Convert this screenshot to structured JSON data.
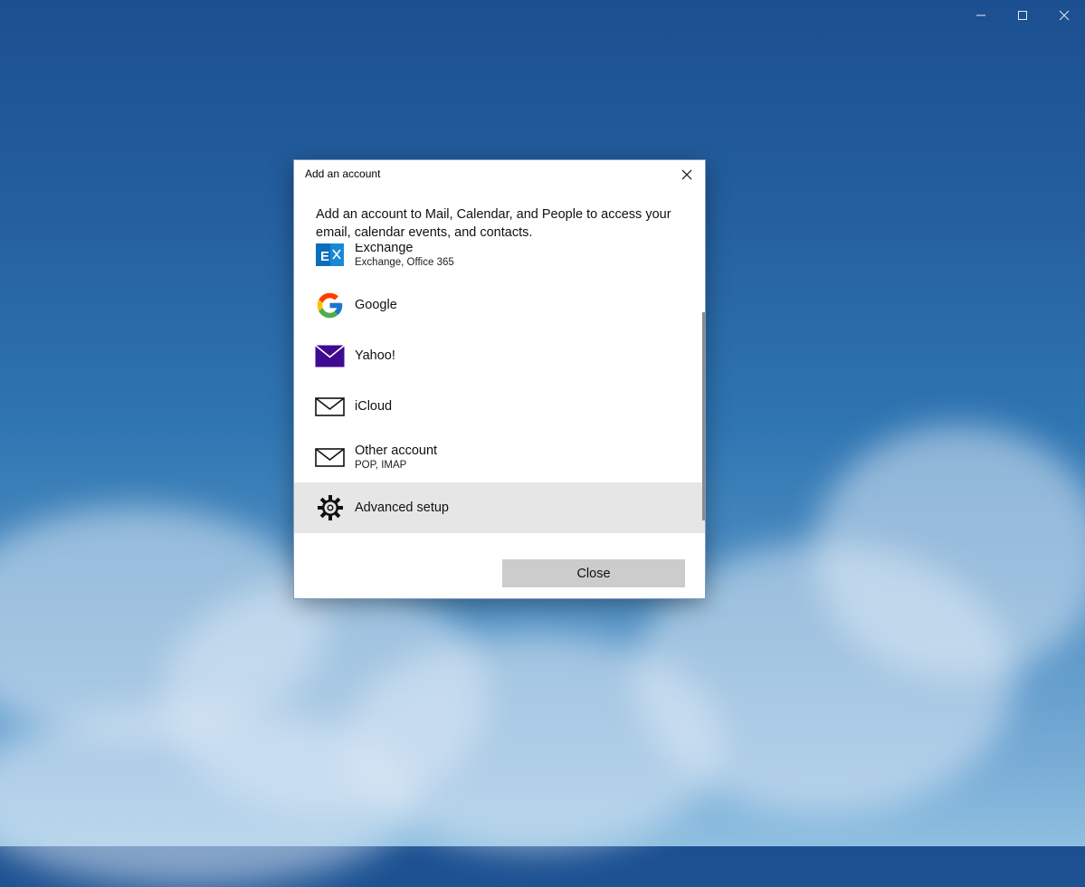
{
  "window": {
    "controls": [
      "minimize-icon",
      "maximize-icon",
      "close-icon"
    ]
  },
  "dialog": {
    "title": "Add an account",
    "description": "Add an account to Mail, Calendar, and People to access your email, calendar events, and contacts.",
    "accounts": [
      {
        "name": "Exchange",
        "sub": "Exchange, Office 365",
        "icon": "exchange-icon"
      },
      {
        "name": "Google",
        "sub": "",
        "icon": "google-icon"
      },
      {
        "name": "Yahoo!",
        "sub": "",
        "icon": "yahoo-mail-icon"
      },
      {
        "name": "iCloud",
        "sub": "",
        "icon": "envelope-icon"
      },
      {
        "name": "Other account",
        "sub": "POP, IMAP",
        "icon": "envelope-icon"
      },
      {
        "name": "Advanced setup",
        "sub": "",
        "icon": "gear-icon"
      }
    ],
    "close_button": "Close"
  },
  "colors": {
    "exchange_blue": "#0a6ebd",
    "yahoo_purple": "#3e0a91",
    "highlight": "#e6e6e6",
    "button_gray": "#cccccc"
  }
}
